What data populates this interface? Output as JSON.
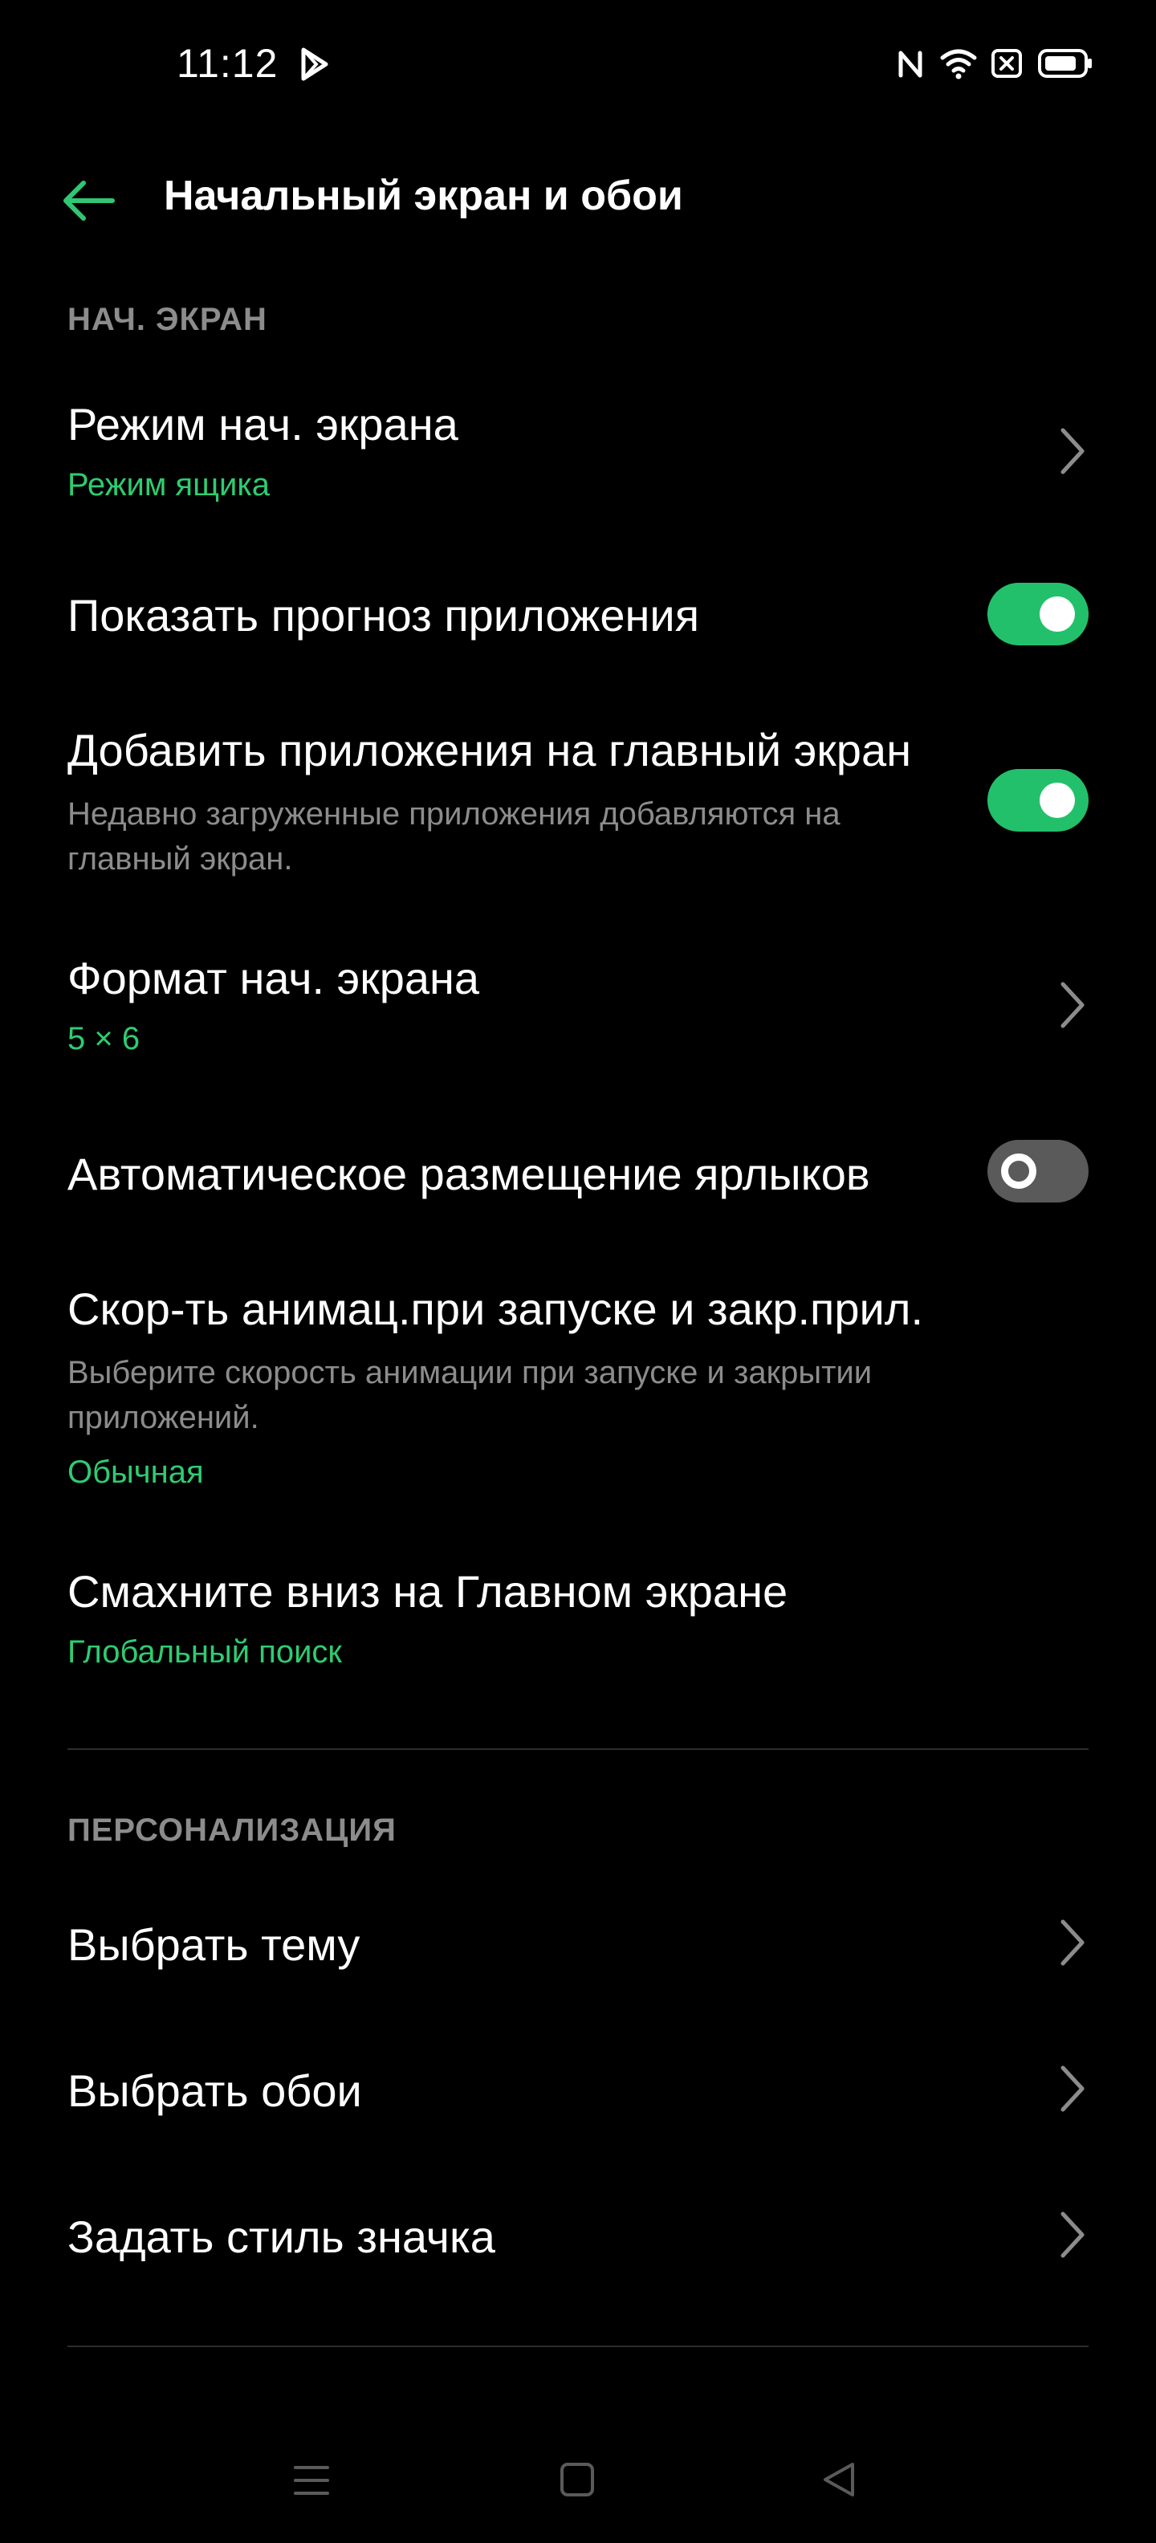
{
  "status_bar": {
    "time": "11:12",
    "icons": [
      "play-store-notification-icon",
      "nfc-icon",
      "wifi-icon",
      "sim-off-icon",
      "battery-icon"
    ]
  },
  "header": {
    "title": "Начальный экран и обои",
    "back_icon": "back-arrow-icon"
  },
  "colors": {
    "accent": "#30c673",
    "toggle_on": "#23c06b",
    "toggle_off": "#5a5a5a",
    "secondary_text": "#8c8c8c",
    "background": "#000000"
  },
  "sections": {
    "home": {
      "header": "НАЧ. ЭКРАН",
      "items": [
        {
          "title": "Режим нач. экрана",
          "value": "Режим ящика"
        },
        {
          "title": "Показать прогноз приложения",
          "toggle": true
        },
        {
          "title": "Добавить приложения на главный экран",
          "description": "Недавно загруженные приложения добавляются на главный экран.",
          "toggle": true
        },
        {
          "title": "Формат нач. экрана",
          "value": "5 × 6"
        },
        {
          "title": "Автоматическое размещение ярлыков",
          "toggle": false
        },
        {
          "title": "Скор-ть анимац.при запуске и закр.прил.",
          "description": "Выберите скорость анимации при запуске и закрытии приложений.",
          "value": "Обычная"
        },
        {
          "title": "Смахните вниз на Главном экране",
          "value": "Глобальный поиск"
        }
      ]
    },
    "personalization": {
      "header": "ПЕРСОНАЛИЗАЦИЯ",
      "items": [
        {
          "title": "Выбрать тему"
        },
        {
          "title": "Выбрать обои"
        },
        {
          "title": "Задать стиль значка"
        }
      ]
    }
  },
  "nav_bar": {
    "icons": [
      "menu-icon",
      "home-icon",
      "back-icon"
    ]
  }
}
